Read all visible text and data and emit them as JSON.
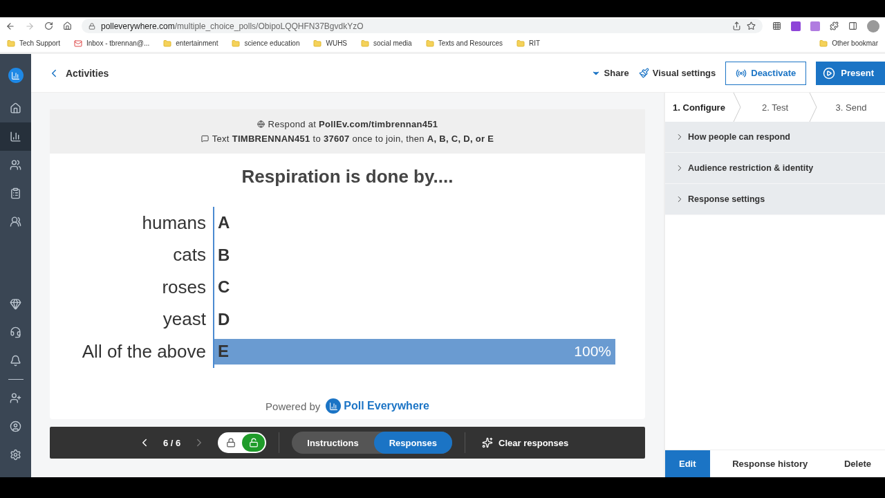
{
  "browser": {
    "url_host": "polleverywhere.com",
    "url_path": "/multiple_choice_polls/ObipoLQQHFN37BgvdkYzO",
    "bookmarks": [
      {
        "label": "Tech Support",
        "kind": "folder"
      },
      {
        "label": "Inbox - tbrennan@...",
        "kind": "mail"
      },
      {
        "label": "entertainment",
        "kind": "folder"
      },
      {
        "label": "science education",
        "kind": "folder"
      },
      {
        "label": "WUHS",
        "kind": "folder"
      },
      {
        "label": "social media",
        "kind": "folder"
      },
      {
        "label": "Texts and Resources",
        "kind": "folder"
      },
      {
        "label": "RIT",
        "kind": "folder"
      }
    ],
    "other_bookmarks": "Other bookmar"
  },
  "sidebar": {
    "items": [
      {
        "kind": "home",
        "selected": false
      },
      {
        "kind": "chart",
        "selected": true
      },
      {
        "kind": "people",
        "selected": false
      },
      {
        "kind": "clipboard",
        "selected": false
      },
      {
        "kind": "group",
        "selected": false
      },
      {
        "kind": "gem",
        "selected": false
      },
      {
        "kind": "headset",
        "selected": false
      },
      {
        "kind": "bell",
        "selected": false
      },
      {
        "kind": "user-plus",
        "selected": false
      },
      {
        "kind": "account",
        "selected": false
      },
      {
        "kind": "settings",
        "selected": false
      }
    ]
  },
  "header": {
    "back_link": "Activities",
    "share": "Share",
    "visual_settings": "Visual settings",
    "deactivate": "Deactivate",
    "present": "Present"
  },
  "poll": {
    "respond_line": "Respond at **PollEv.com/timbrennan451**",
    "text_line": "Text **TIMBRENNAN451** to **37607** once to join, then **A, B, C, D, or E**",
    "title": "Respiration is done by....",
    "options": [
      {
        "label": "humans",
        "letter": "A"
      },
      {
        "label": "cats",
        "letter": "B"
      },
      {
        "label": "roses",
        "letter": "C"
      },
      {
        "label": "yeast",
        "letter": "D"
      },
      {
        "label": "All of the above",
        "letter": "E",
        "level": 1,
        "reading": "100%"
      }
    ],
    "powered_by": "Powered by",
    "brand": "Poll Everywhere"
  },
  "toolbar": {
    "counter": "6 / 6",
    "locked": false,
    "modes": [
      {
        "label": "Instructions",
        "selected": false
      },
      {
        "label": "Responses",
        "selected": true
      }
    ],
    "clear": "Clear responses"
  },
  "steps": [
    {
      "label": "1. Configure",
      "selected": true
    },
    {
      "label": "2. Test",
      "selected": false
    },
    {
      "label": "3. Send",
      "selected": false
    }
  ],
  "accordions": [
    {
      "label": "How people can respond",
      "expanded": false
    },
    {
      "label": "Audience restriction & identity",
      "expanded": false
    },
    {
      "label": "Response settings",
      "expanded": false
    }
  ],
  "footer_buttons": [
    {
      "label": "Edit",
      "selected": true
    },
    {
      "label": "Response history",
      "selected": false
    },
    {
      "label": "Delete",
      "selected": false
    }
  ]
}
